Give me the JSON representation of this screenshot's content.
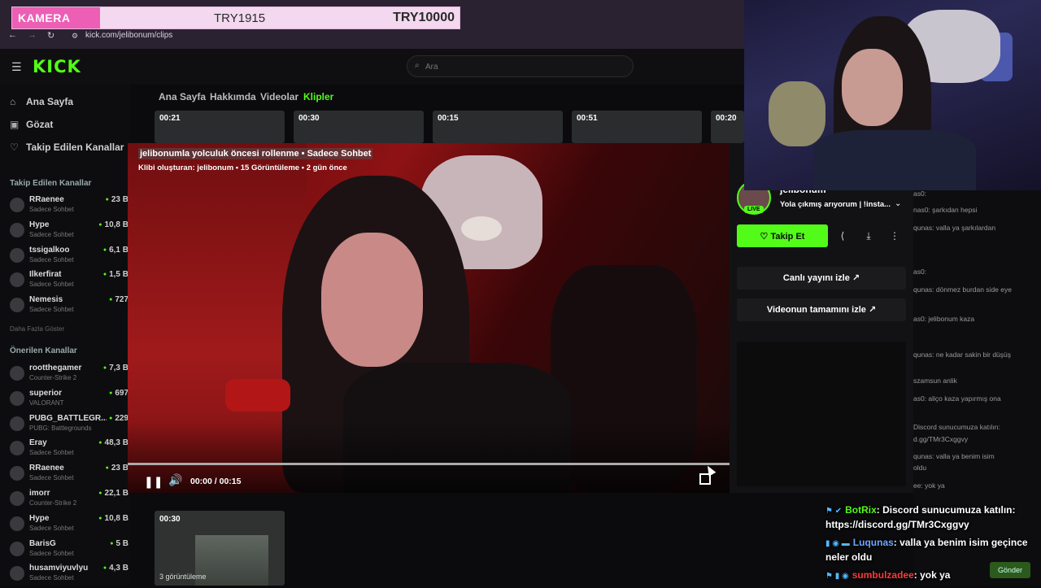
{
  "overlay": {
    "camera_label": "KAMERA",
    "amount_current": "TRY1915",
    "amount_goal": "TRY10000"
  },
  "browser": {
    "url": "kick.com/jelibonum/clips"
  },
  "header": {
    "logo": "KICK",
    "search_placeholder": "Ara"
  },
  "sidebar": {
    "nav": [
      {
        "label": "Ana Sayfa",
        "icon": "home-icon"
      },
      {
        "label": "Gözat",
        "icon": "browse-icon"
      },
      {
        "label": "Takip Edilen Kanallar",
        "icon": "heart-icon"
      }
    ],
    "followed_heading": "Takip Edilen Kanallar",
    "followed": [
      {
        "name": "RRaenee",
        "category": "Sadece Sohbet",
        "viewers": "23 B"
      },
      {
        "name": "Hype",
        "category": "Sadece Sohbet",
        "viewers": "10,8 B"
      },
      {
        "name": "tssigalkoo",
        "category": "Sadece Sohbet",
        "viewers": "6,1 B"
      },
      {
        "name": "Ilkerfirat",
        "category": "Sadece Sohbet",
        "viewers": "1,5 B"
      },
      {
        "name": "Nemesis",
        "category": "Sadece Sohbet",
        "viewers": "727"
      }
    ],
    "show_more": "Daha Fazla Göster",
    "recommended_heading": "Önerilen Kanallar",
    "recommended": [
      {
        "name": "rootthegamer",
        "category": "Counter-Strike 2",
        "viewers": "7,3 B"
      },
      {
        "name": "superior",
        "category": "VALORANT",
        "viewers": "697"
      },
      {
        "name": "PUBG_BATTLEGR...",
        "category": "PUBG: Battlegrounds",
        "viewers": "229"
      },
      {
        "name": "Eray",
        "category": "Sadece Sohbet",
        "viewers": "48,3 B"
      },
      {
        "name": "RRaenee",
        "category": "Sadece Sohbet",
        "viewers": "23 B"
      },
      {
        "name": "imorr",
        "category": "Counter-Strike 2",
        "viewers": "22,1 B"
      },
      {
        "name": "Hype",
        "category": "Sadece Sohbet",
        "viewers": "10,8 B"
      },
      {
        "name": "BarisG",
        "category": "Sadece Sohbet",
        "viewers": "5 B"
      },
      {
        "name": "husamviyuvlyu",
        "category": "Sadece Sohbet",
        "viewers": "4,3 B"
      }
    ]
  },
  "tabs": [
    {
      "label": "Ana Sayfa",
      "active": false
    },
    {
      "label": "Hakkımda",
      "active": false
    },
    {
      "label": "Videolar",
      "active": false
    },
    {
      "label": "Klipler",
      "active": true
    }
  ],
  "clip_strip": [
    "00:21",
    "00:30",
    "00:15",
    "00:51",
    "00:20"
  ],
  "player": {
    "title": "jelibonumla yolculuk öncesi rollenme • Sadece Sohbet",
    "meta": "Klibi oluşturan: jelibonum • 15 Görüntüleme • 2 gün önce",
    "time": "00:00 / 00:15",
    "progress": 0.0
  },
  "channel": {
    "name": "jelibonum",
    "live_badge": "LIVE",
    "stream_title": "Yola çıkmış arıyorum | !insta...",
    "follow_label": "Takip Et",
    "watch_live_label": "Canlı yayını izle",
    "watch_full_label": "Videonun tamamını izle"
  },
  "bottom_clip": {
    "duration": "00:30",
    "views": "3 görüntüleme"
  },
  "chat_bg": [
    "as0:",
    "nas0: şarkıdan hepsi",
    "qunas: valla ya şarkılardan",
    "as0:",
    "qunas: dönmez burdan side eye",
    "as0: jelibonum kaza",
    "qunas: ne kadar sakin bir düşüş",
    "szamsun anlik",
    "as0: aliço kaza yapırmış ona",
    "Discord sunucumuza katılın:",
    "d.gg/TMr3Cxggvy",
    "qunas: valla ya benim isim",
    "oldu",
    "ee: yok ya"
  ],
  "overlay_chat": [
    {
      "user": "BotRix",
      "text": ": Discord sunucumuza katılın:",
      "badges": "⚑ ✔"
    },
    {
      "user": "",
      "text": "https://discord.gg/TMr3Cxggvy",
      "badges": ""
    },
    {
      "user": "Luqunas",
      "text": ": valla ya benim isim geçince",
      "badges": "▮ ◉ ▬"
    },
    {
      "user": "",
      "text": "neler oldu",
      "badges": ""
    },
    {
      "user": "sumbulzadee",
      "text": ": yok ya",
      "badges": "⚑ ▮ ◉"
    }
  ],
  "chat_send_label": "Gönder",
  "colors": {
    "brand": "#53fc18",
    "overlay_pink": "#ec5fb4"
  }
}
